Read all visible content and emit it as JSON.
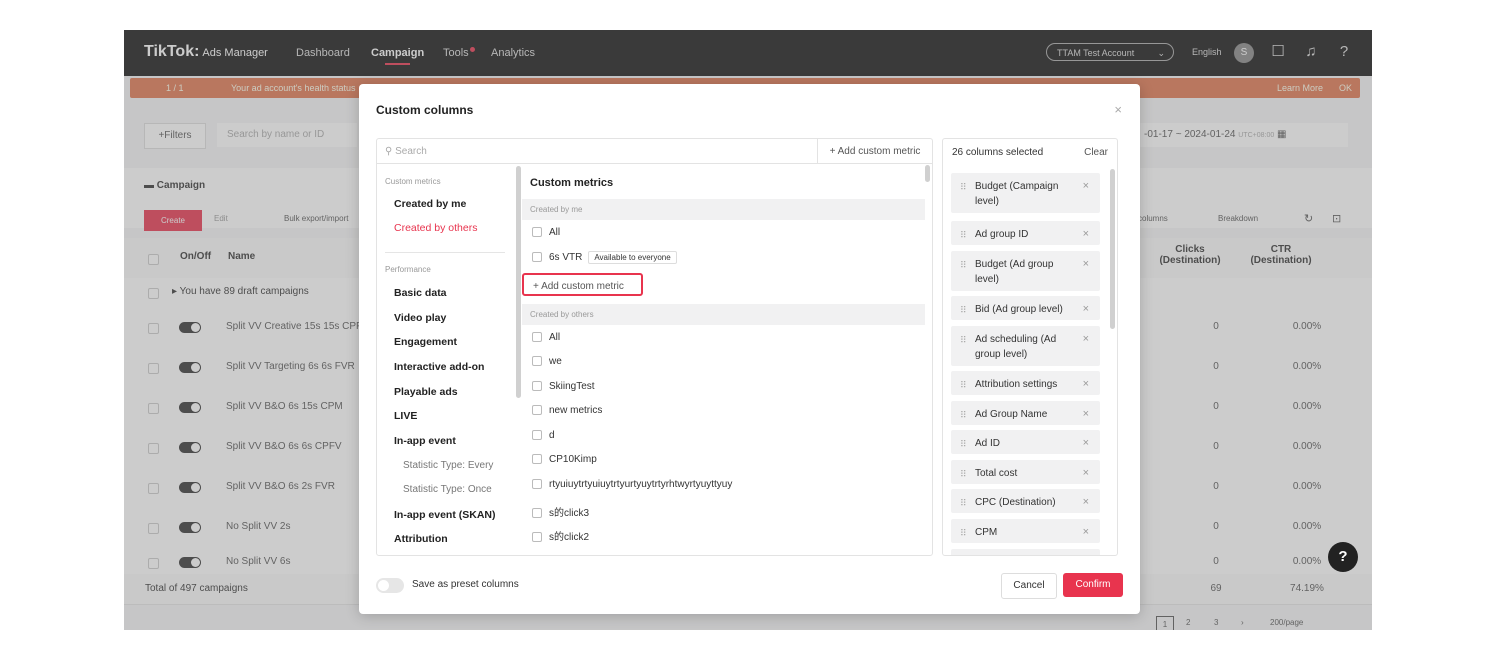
{
  "header": {
    "brand": "TikTok:",
    "product": "Ads Manager",
    "nav": [
      "Dashboard",
      "Campaign",
      "Tools",
      "Analytics"
    ],
    "account": "TTAM Test Account",
    "language": "English",
    "avatar_initial": "S"
  },
  "banner": {
    "pager": "1 / 1",
    "text": "Your ad account's health status",
    "learn_more": "Learn More",
    "ok": "OK"
  },
  "toolbar": {
    "filters": "+Filters",
    "search_placeholder": "Search by name or ID",
    "date_start": "-01-17",
    "date_sep": "~",
    "date_end": "2024-01-24",
    "timezone": "UTC+08:00"
  },
  "campaign": {
    "title": "Campaign",
    "create": "Create",
    "edit": "Edit",
    "bulk": "Bulk export/import",
    "columns": "columns",
    "breakdown": "Breakdown",
    "col_onoff": "On/Off",
    "col_name": "Name",
    "col_clicks": "Clicks (Destination)",
    "col_ctr": "CTR (Destination)",
    "draft": "You have 89 draft campaigns",
    "rows": [
      {
        "name": "Split VV Creative 15s 15s CPF",
        "clicks": "0",
        "ctr": "0.00%"
      },
      {
        "name": "Split VV Targeting 6s 6s FVR",
        "clicks": "0",
        "ctr": "0.00%"
      },
      {
        "name": "Split VV B&O 6s 15s CPM",
        "clicks": "0",
        "ctr": "0.00%"
      },
      {
        "name": "Split VV B&O 6s 6s CPFV",
        "clicks": "0",
        "ctr": "0.00%"
      },
      {
        "name": "Split VV B&O 6s 2s FVR",
        "clicks": "0",
        "ctr": "0.00%"
      },
      {
        "name": "No Split VV 2s",
        "clicks": "0",
        "ctr": "0.00%"
      },
      {
        "name": "No Split VV 6s",
        "clicks": "0",
        "ctr": "0.00%"
      }
    ],
    "total_label": "Total of 497 campaigns",
    "total_clicks": "69",
    "total_ctr": "74.19%",
    "pages": [
      "1",
      "2",
      "3"
    ],
    "page_size": "200/page"
  },
  "modal": {
    "title": "Custom columns",
    "search_placeholder": "Search",
    "add_custom_metric": "+ Add custom metric",
    "categories": {
      "custom_head": "Custom metrics",
      "created_by_me": "Created by me",
      "created_by_others": "Created by others",
      "performance_head": "Performance",
      "items": [
        "Basic data",
        "Video play",
        "Engagement",
        "Interactive add-on",
        "Playable ads",
        "LIVE",
        "In-app event"
      ],
      "sub_items": [
        "Statistic Type: Every",
        "Statistic Type: Once"
      ],
      "items2": [
        "In-app event (SKAN)",
        "Attribution"
      ]
    },
    "metrics": {
      "heading": "Custom metrics",
      "group_me": "Created by me",
      "me_items": [
        "All",
        "6s VTR"
      ],
      "badge": "Available to everyone",
      "add_custom_metric": "+ Add custom metric",
      "group_others": "Created by others",
      "others_items": [
        "All",
        "we",
        "SkiingTest",
        "new metrics",
        "d",
        "CP10Kimp",
        "rtyuiuytrtyuiuytrtyurtyuytrtyrhtwyrtyuyttyuy",
        "s的click3",
        "s的click2"
      ]
    },
    "selected": {
      "count_label": "26 columns selected",
      "clear": "Clear",
      "items": [
        "Budget (Campaign level)",
        "Ad group ID",
        "Budget (Ad group level)",
        "Bid (Ad group level)",
        "Ad scheduling (Ad group level)",
        "Attribution settings",
        "Ad Group Name",
        "Ad ID",
        "Total cost",
        "CPC (Destination)",
        "CPM"
      ]
    },
    "preset_label": "Save as preset columns",
    "cancel": "Cancel",
    "confirm": "Confirm"
  },
  "colors": {
    "accent": "#e8344e",
    "topbar": "#141414",
    "banner": "#e0764f"
  }
}
